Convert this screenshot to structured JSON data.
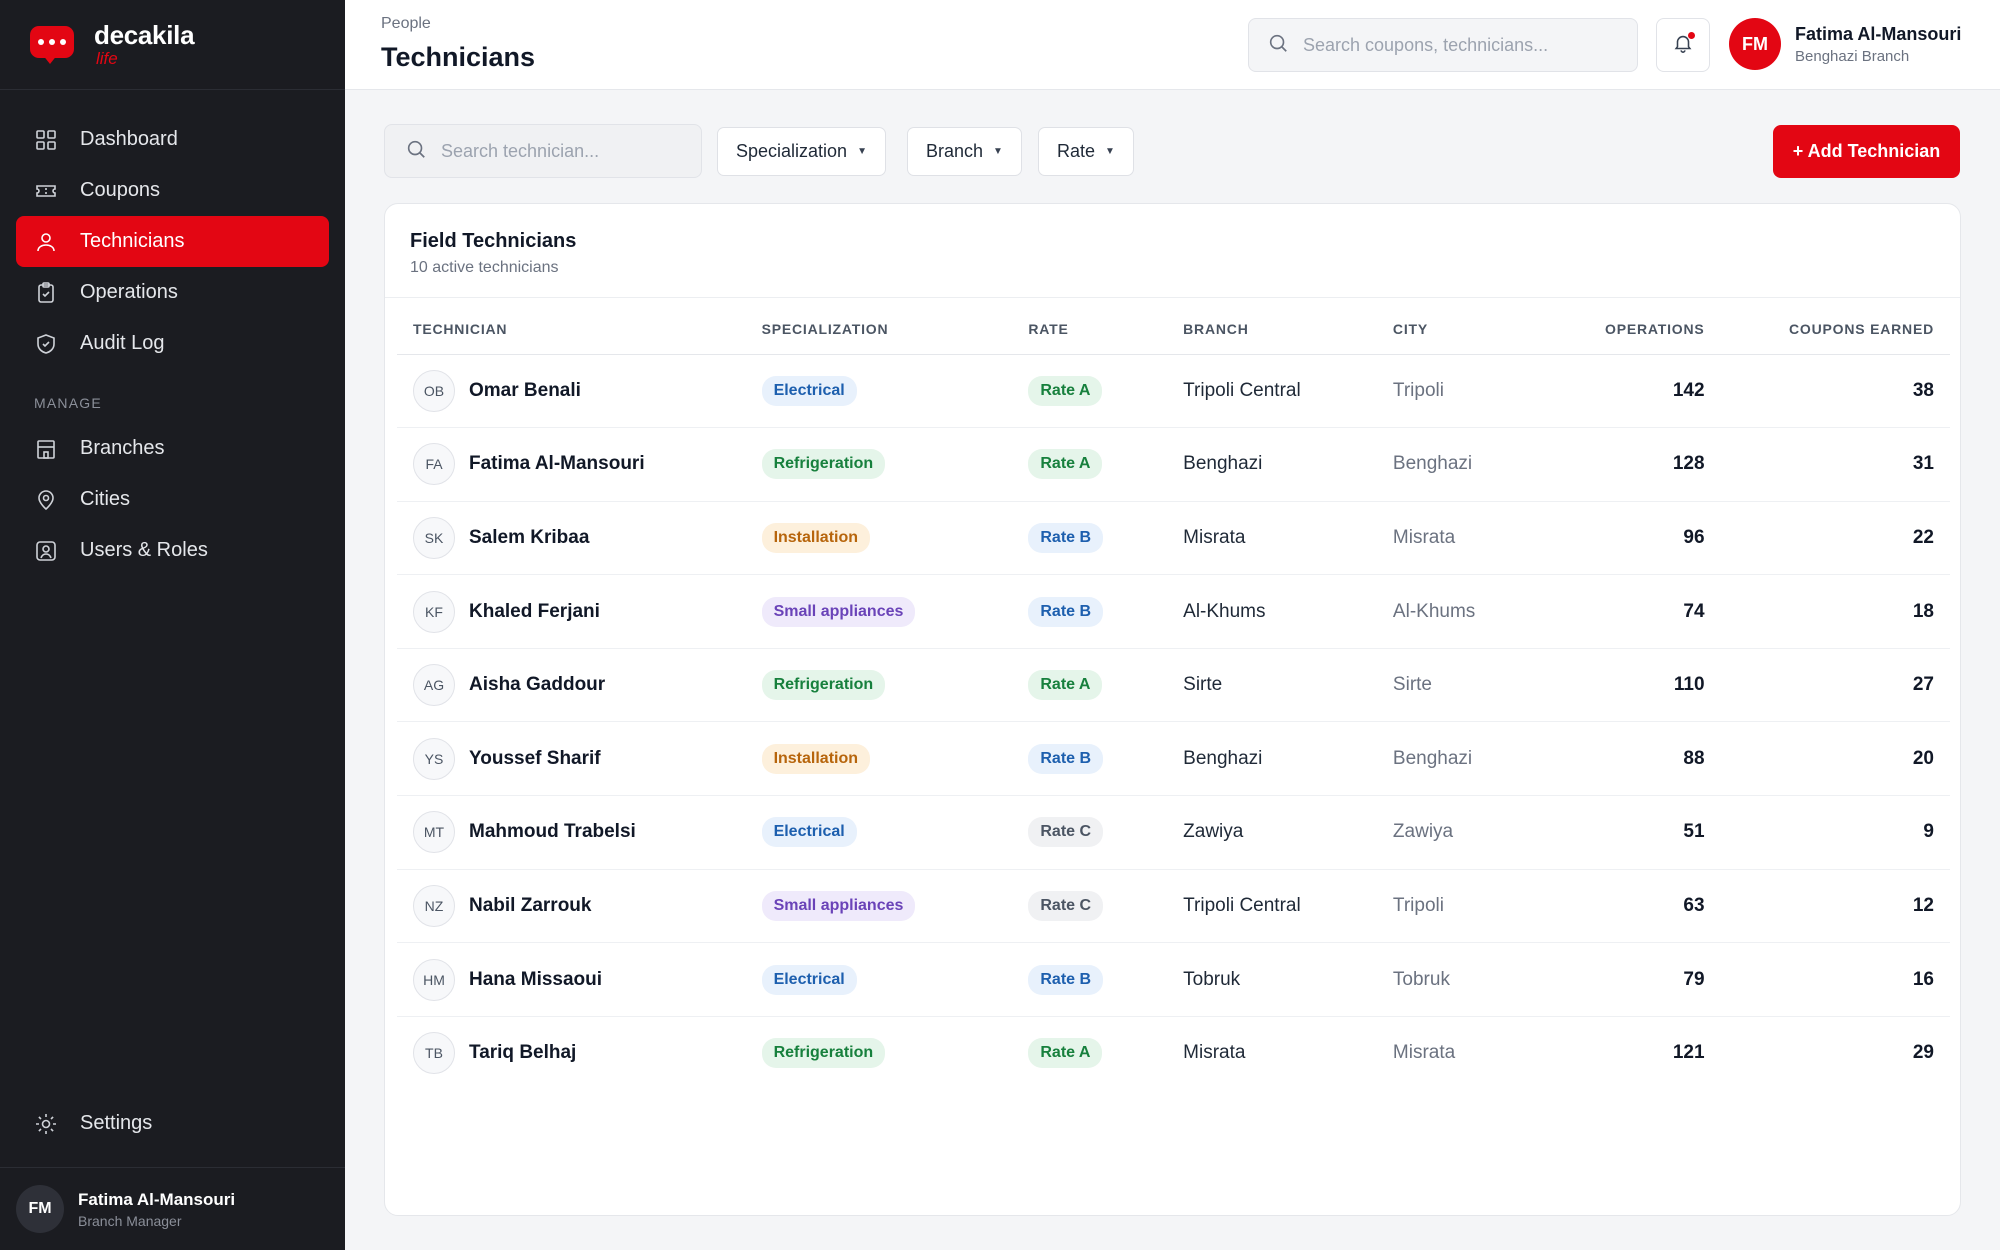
{
  "brand": {
    "name": "decakila",
    "sub": "life"
  },
  "nav": {
    "items": [
      {
        "label": "Dashboard",
        "icon": "grid-icon"
      },
      {
        "label": "Coupons",
        "icon": "ticket-icon"
      },
      {
        "label": "Technicians",
        "icon": "user-icon",
        "active": true
      },
      {
        "label": "Operations",
        "icon": "clipboard-icon"
      },
      {
        "label": "Audit Log",
        "icon": "shield-icon"
      }
    ],
    "manage_label": "MANAGE",
    "manage_items": [
      {
        "label": "Branches",
        "icon": "building-icon"
      },
      {
        "label": "Cities",
        "icon": "map-pin-icon"
      },
      {
        "label": "Users & Roles",
        "icon": "user-badge-icon"
      }
    ],
    "settings_label": "Settings"
  },
  "sidebar_user": {
    "initials": "FM",
    "name": "Fatima Al-Mansouri",
    "role": "Branch Manager"
  },
  "header": {
    "breadcrumb": "People",
    "title": "Technicians",
    "search_placeholder": "Search coupons, technicians...",
    "user": {
      "initials": "FM",
      "name": "Fatima Al-Mansouri",
      "branch": "Benghazi Branch"
    }
  },
  "filters": {
    "search_placeholder": "Search technician...",
    "specialization": "Specialization",
    "branch": "Branch",
    "rate": "Rate",
    "add_button": "+ Add Technician"
  },
  "card": {
    "title": "Field Technicians",
    "subtitle": "10 active technicians"
  },
  "table": {
    "headers": {
      "technician": "TECHNICIAN",
      "specialization": "SPECIALIZATION",
      "rate": "RATE",
      "branch": "BRANCH",
      "city": "CITY",
      "operations": "OPERATIONS",
      "coupons": "COUPONS EARNED"
    },
    "rows": [
      {
        "initials": "OB",
        "name": "Omar Benali",
        "spec": "Electrical",
        "rate": "Rate A",
        "branch": "Tripoli Central",
        "city": "Tripoli",
        "operations": "142",
        "coupons": "38"
      },
      {
        "initials": "FA",
        "name": "Fatima Al-Mansouri",
        "spec": "Refrigeration",
        "rate": "Rate A",
        "branch": "Benghazi",
        "city": "Benghazi",
        "operations": "128",
        "coupons": "31"
      },
      {
        "initials": "SK",
        "name": "Salem Kribaa",
        "spec": "Installation",
        "rate": "Rate B",
        "branch": "Misrata",
        "city": "Misrata",
        "operations": "96",
        "coupons": "22"
      },
      {
        "initials": "KF",
        "name": "Khaled Ferjani",
        "spec": "Small appliances",
        "rate": "Rate B",
        "branch": "Al-Khums",
        "city": "Al-Khums",
        "operations": "74",
        "coupons": "18"
      },
      {
        "initials": "AG",
        "name": "Aisha Gaddour",
        "spec": "Refrigeration",
        "rate": "Rate A",
        "branch": "Sirte",
        "city": "Sirte",
        "operations": "110",
        "coupons": "27"
      },
      {
        "initials": "YS",
        "name": "Youssef Sharif",
        "spec": "Installation",
        "rate": "Rate B",
        "branch": "Benghazi",
        "city": "Benghazi",
        "operations": "88",
        "coupons": "20"
      },
      {
        "initials": "MT",
        "name": "Mahmoud Trabelsi",
        "spec": "Electrical",
        "rate": "Rate C",
        "branch": "Zawiya",
        "city": "Zawiya",
        "operations": "51",
        "coupons": "9"
      },
      {
        "initials": "NZ",
        "name": "Nabil Zarrouk",
        "spec": "Small appliances",
        "rate": "Rate C",
        "branch": "Tripoli Central",
        "city": "Tripoli",
        "operations": "63",
        "coupons": "12"
      },
      {
        "initials": "HM",
        "name": "Hana Missaoui",
        "spec": "Electrical",
        "rate": "Rate B",
        "branch": "Tobruk",
        "city": "Tobruk",
        "operations": "79",
        "coupons": "16"
      },
      {
        "initials": "TB",
        "name": "Tariq Belhaj",
        "spec": "Refrigeration",
        "rate": "Rate A",
        "branch": "Misrata",
        "city": "Misrata",
        "operations": "121",
        "coupons": "29"
      }
    ]
  },
  "colors": {
    "accent": "#e30613",
    "sidebar_bg": "#1b1c21",
    "spec": {
      "Electrical": {
        "bg": "#e8f1fc",
        "fg": "#1d5fae"
      },
      "Refrigeration": {
        "bg": "#e5f5ea",
        "fg": "#17803d"
      },
      "Installation": {
        "bg": "#fdf0dc",
        "fg": "#b7650c"
      },
      "Small appliances": {
        "bg": "#efeafb",
        "fg": "#6a43b8"
      }
    },
    "rate": {
      "Rate A": {
        "bg": "#e5f5ea",
        "fg": "#17803d"
      },
      "Rate B": {
        "bg": "#e8f1fc",
        "fg": "#1d5fae"
      },
      "Rate C": {
        "bg": "#f0f1f3",
        "fg": "#4b5563"
      }
    }
  }
}
